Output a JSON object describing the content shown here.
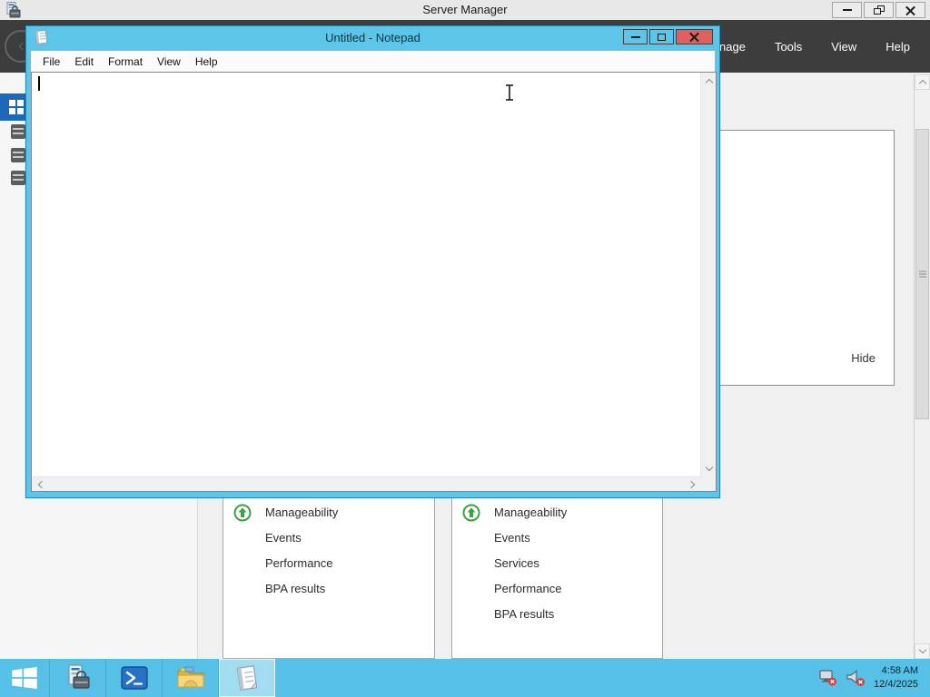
{
  "server_manager": {
    "window_title": "Server Manager",
    "menu": [
      "Manage",
      "Tools",
      "View",
      "Help"
    ],
    "details_panel": {
      "hide_label": "Hide"
    },
    "tiles": [
      {
        "status_icon": "green-circle-up-arrow",
        "rows": [
          "Manageability",
          "Events",
          "Performance",
          "BPA results"
        ]
      },
      {
        "status_icon": "green-circle-up-arrow",
        "rows": [
          "Manageability",
          "Events",
          "Services",
          "Performance",
          "BPA results"
        ]
      }
    ]
  },
  "notepad": {
    "window_title": "Untitled - Notepad",
    "menu": [
      "File",
      "Edit",
      "Format",
      "View",
      "Help"
    ],
    "editor_text": ""
  },
  "taskbar": {
    "tray": {
      "time": "4:58 AM",
      "date": "12/4/2025"
    }
  },
  "icons": {
    "start": "windows-logo",
    "server_manager": "server-with-toolbox",
    "powershell": "blue-prompt-window",
    "explorer": "yellow-folder",
    "notepad": "notepad-pad",
    "network_status": "monitor-with-red-x",
    "volume_status": "speaker-with-red-x",
    "tile_status": "green-circle-up-arrow"
  },
  "colors": {
    "accent_cyan": "#57c0e6",
    "close_red": "#e0605e",
    "dark_band": "#3d3d3d",
    "selection_blue": "#1e68b8",
    "status_green": "#37a43f"
  }
}
